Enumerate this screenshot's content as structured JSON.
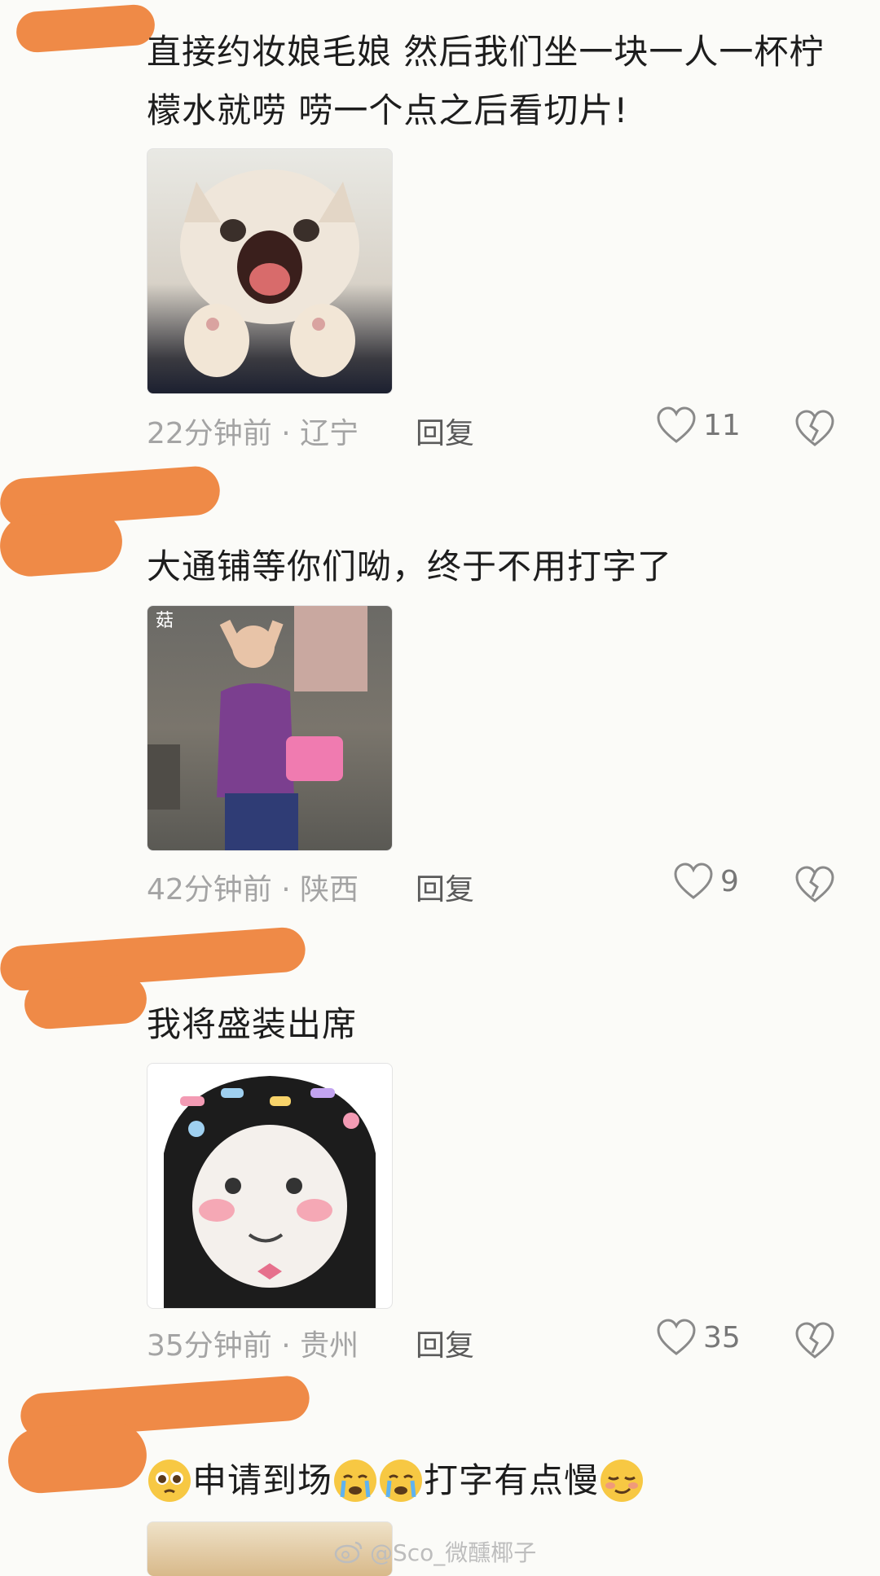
{
  "comments": [
    {
      "text": "直接约妆娘毛娘 然后我们坐一块一人一杯柠檬水就唠 唠一个点之后看切片!",
      "sticker": "screaming-cat-sticker",
      "time": "22分钟前",
      "location": "辽宁",
      "reply_label": "回复",
      "likes": "11"
    },
    {
      "text": "大通铺等你们呦，终于不用打字了",
      "sticker": "woman-in-purple-dress-sticker",
      "sticker_badge": "菇",
      "time": "42分钟前",
      "location": "陕西",
      "reply_label": "回复",
      "likes": "9"
    },
    {
      "text": "我将盛装出席",
      "sticker": "face-with-hairclips-sticker",
      "time": "35分钟前",
      "location": "贵州",
      "reply_label": "回复",
      "likes": "35"
    },
    {
      "text_parts": [
        "申请到场",
        "打字有点慢"
      ],
      "emojis": [
        "pleading-face-icon",
        "crying-face-icon",
        "crying-face-icon",
        "smirking-face-icon"
      ]
    }
  ],
  "separator": " · ",
  "watermark": "@Sco_微醺椰子",
  "colors": {
    "redaction": "#ef8a47",
    "background": "#fbfbf8",
    "meta_text": "#a4a4a4"
  }
}
